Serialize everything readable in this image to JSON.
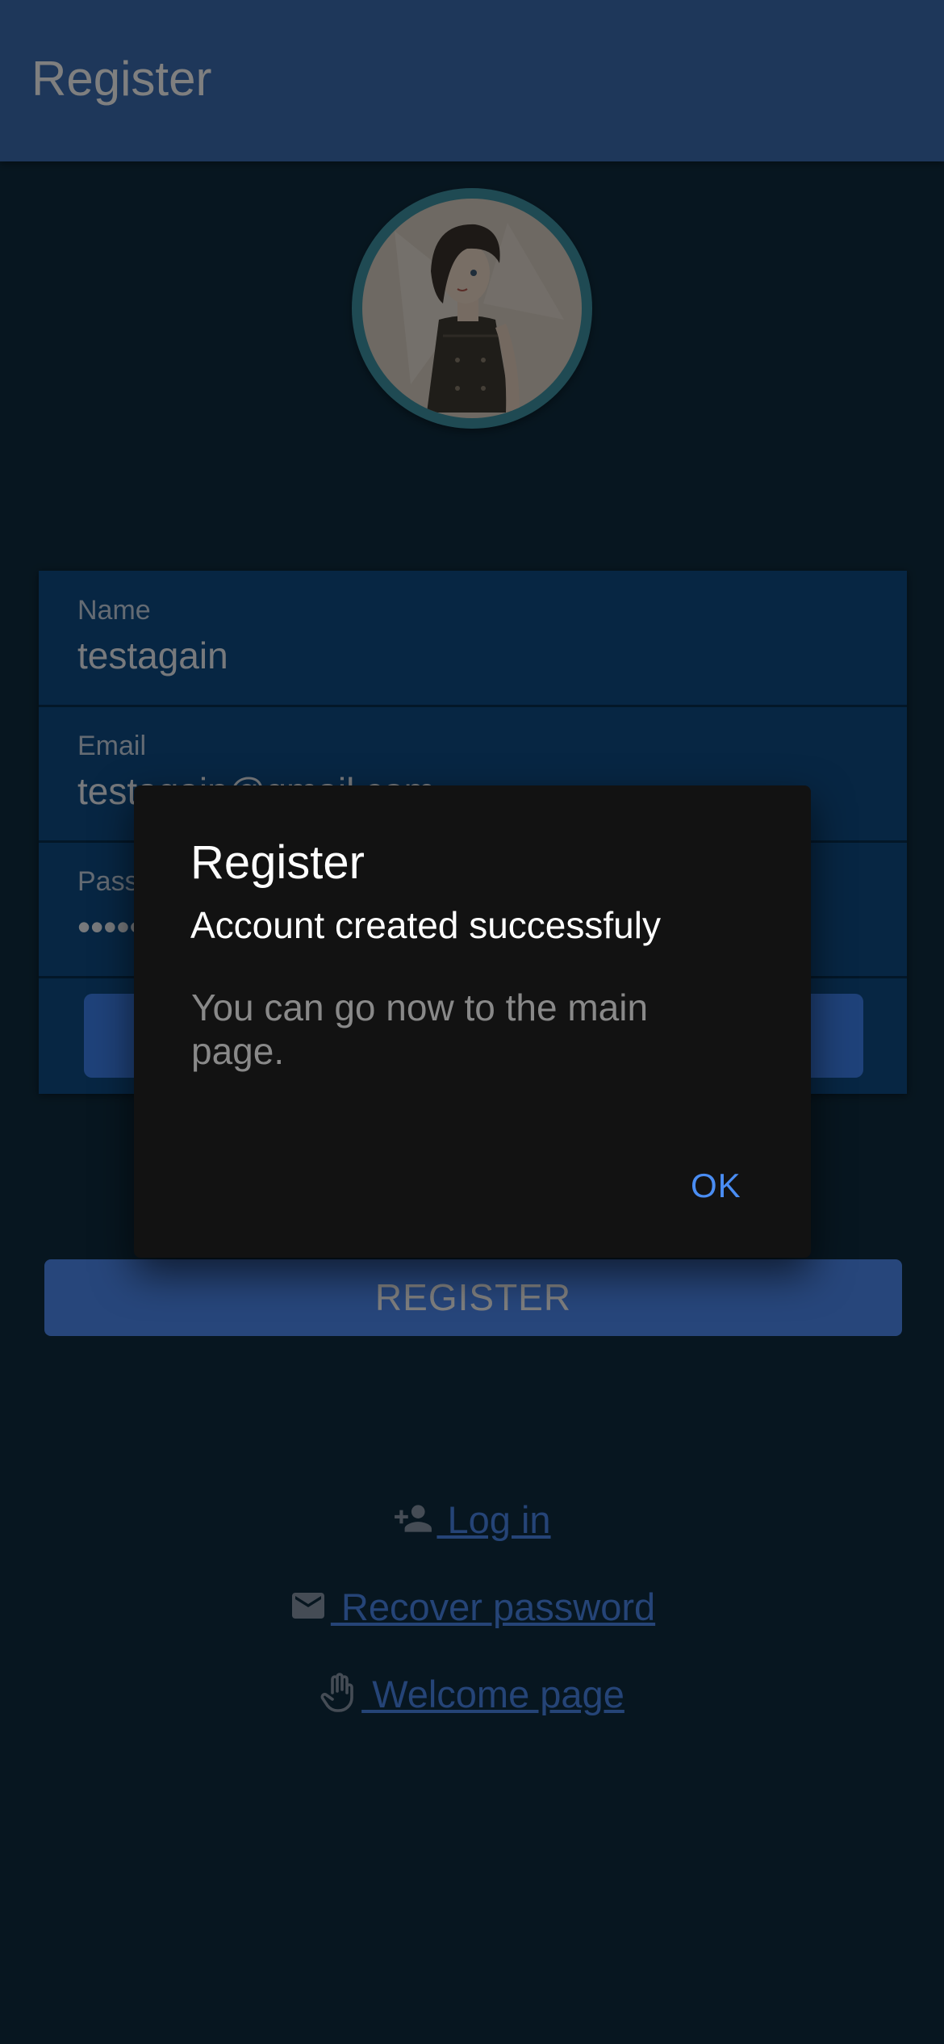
{
  "header": {
    "title": "Register"
  },
  "form": {
    "name": {
      "label": "Name",
      "value": "testagain"
    },
    "email": {
      "label": "Email",
      "value": "testagain@gmail.com"
    },
    "password": {
      "label": "Password",
      "value": "••••••••"
    }
  },
  "register_button": {
    "label": "REGISTER"
  },
  "links": {
    "login": {
      "label": " Log in",
      "icon": "person-add-icon"
    },
    "recover": {
      "label": " Recover password",
      "icon": "mail-icon"
    },
    "welcome": {
      "label": " Welcome page",
      "icon": "hand-icon"
    }
  },
  "dialog": {
    "title": "Register",
    "subtitle": "Account created successfuly",
    "message": "You can go now to the main page.",
    "ok_label": "OK"
  },
  "colors": {
    "app_bar": "#3d6fb5",
    "background": "#0f2d40",
    "link": "#4a88ee",
    "dialog_bg": "#121212",
    "accent": "#4a8df3"
  }
}
